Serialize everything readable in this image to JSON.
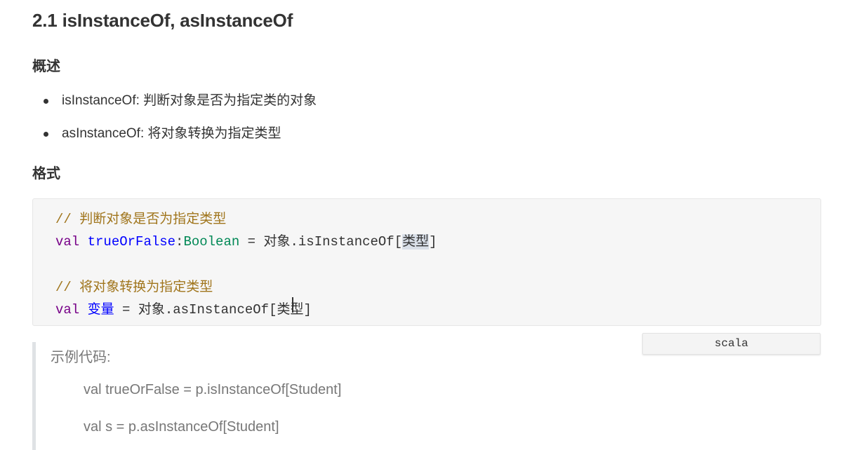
{
  "title": "2.1 isInstanceOf, asInstanceOf",
  "overview": {
    "heading": "概述",
    "items": [
      "isInstanceOf:  判断对象是否为指定类的对象",
      "asInstanceOf: 将对象转换为指定类型"
    ]
  },
  "format": {
    "heading": "格式",
    "code": {
      "comment1": "// 判断对象是否为指定类型",
      "line1_keyword": "val",
      "line1_name": "trueOrFalse",
      "line1_colon": ":",
      "line1_type": "Boolean",
      "line1_rest": " = 对象.isInstanceOf[",
      "line1_param": "类型",
      "line1_end": "]",
      "comment2": "// 将对象转换为指定类型",
      "line2_keyword": "val",
      "line2_name": "变量",
      "line2_rest": " = 对象.asInstanceOf[",
      "line2_param": "类型",
      "line2_end": "]"
    },
    "language": "scala"
  },
  "example": {
    "label": "示例代码:",
    "lines": [
      "val trueOrFalse = p.isInstanceOf[Student]",
      "val s = p.asInstanceOf[Student]"
    ]
  }
}
